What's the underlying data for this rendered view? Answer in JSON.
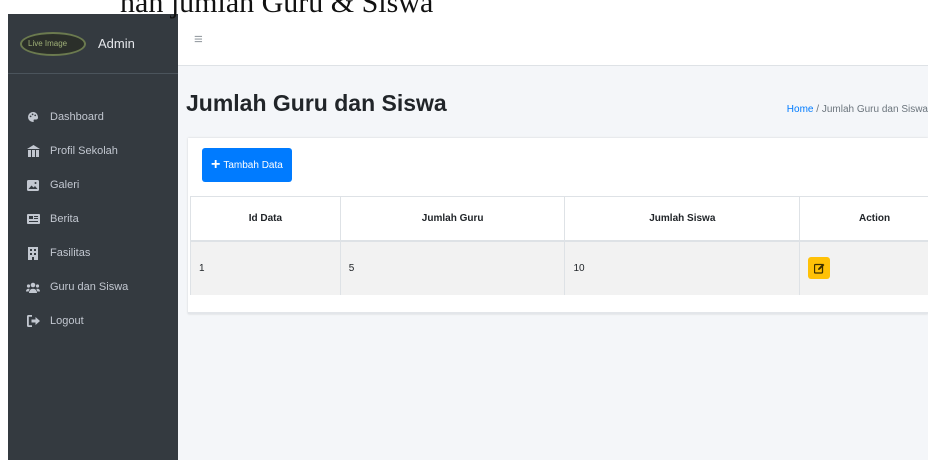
{
  "caption": "nah jumlah Guru & Siswa",
  "brand": {
    "logo_text": "Live Image",
    "name": "Admin"
  },
  "sidebar": {
    "items": [
      {
        "label": "Dashboard",
        "icon": "palette-icon"
      },
      {
        "label": "Profil Sekolah",
        "icon": "school-icon"
      },
      {
        "label": "Galeri",
        "icon": "image-icon"
      },
      {
        "label": "Berita",
        "icon": "newspaper-icon"
      },
      {
        "label": "Fasilitas",
        "icon": "building-icon"
      },
      {
        "label": "Guru dan Siswa",
        "icon": "users-icon"
      },
      {
        "label": "Logout",
        "icon": "sign-out-icon"
      }
    ]
  },
  "topbar": {
    "menu_icon": "≡"
  },
  "header": {
    "title": "Jumlah Guru dan Siswa",
    "breadcrumb_home": "Home",
    "breadcrumb_sep": "/",
    "breadcrumb_current": "Jumlah Guru dan Siswa"
  },
  "card": {
    "add_button_label": "Tambah Data",
    "columns": [
      "Id Data",
      "Jumlah Guru",
      "Jumlah Siswa",
      "Action"
    ],
    "rows": [
      {
        "id": "1",
        "guru": "5",
        "siswa": "10"
      }
    ]
  },
  "colors": {
    "sidebar": "#343a40",
    "primary": "#007bff",
    "warning": "#ffc107",
    "background": "#f4f6f9"
  }
}
